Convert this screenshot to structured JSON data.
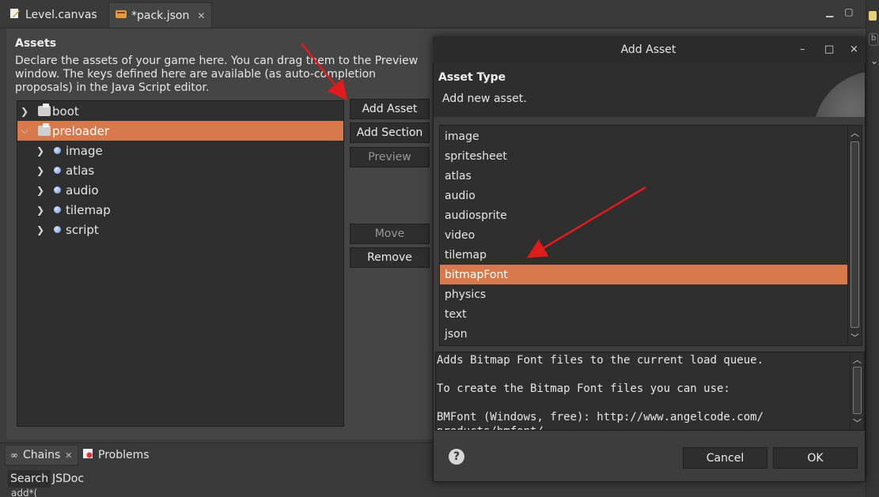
{
  "editor_tabs": [
    {
      "label": "Level.canvas",
      "icon": "pencil-doc-icon"
    },
    {
      "label": "*pack.json",
      "icon": "pack-json-icon"
    }
  ],
  "assets": {
    "title": "Assets",
    "description": "Declare the assets of your game here. You can drag them to the Preview window. The keys defined here are available (as auto-completion proposals) in the Java Script editor."
  },
  "tree": [
    {
      "label": "boot",
      "kind": "section",
      "selected": false
    },
    {
      "label": "preloader",
      "kind": "section",
      "selected": true
    },
    {
      "label": "image",
      "kind": "item"
    },
    {
      "label": "atlas",
      "kind": "item"
    },
    {
      "label": "audio",
      "kind": "item"
    },
    {
      "label": "tilemap",
      "kind": "item"
    },
    {
      "label": "script",
      "kind": "item"
    }
  ],
  "buttons": {
    "add_asset": "Add Asset",
    "add_section": "Add Section",
    "preview": "Preview",
    "move": "Move",
    "remove": "Remove"
  },
  "bottom": {
    "tabs": [
      {
        "label": "Chains"
      },
      {
        "label": "Problems"
      }
    ],
    "subtabs": [
      {
        "label": "Search"
      },
      {
        "label": "JSDoc"
      }
    ],
    "text": "add*("
  },
  "dialog": {
    "title": "Add Asset",
    "header_title": "Asset Type",
    "header_sub": "Add new asset.",
    "types": [
      "image",
      "spritesheet",
      "atlas",
      "audio",
      "audiosprite",
      "video",
      "tilemap",
      "bitmapFont",
      "physics",
      "text",
      "json"
    ],
    "selected_type": "bitmapFont",
    "description": "Adds Bitmap Font files to the current load queue.\n\nTo create the Bitmap Font files you can use:\n\nBMFont (Windows, free): http://www.angelcode.com/\nproducts/bmfont/",
    "cancel": "Cancel",
    "ok": "OK"
  },
  "colors": {
    "accent": "#d8794c",
    "annotation_arrow": "#e01b1b"
  }
}
